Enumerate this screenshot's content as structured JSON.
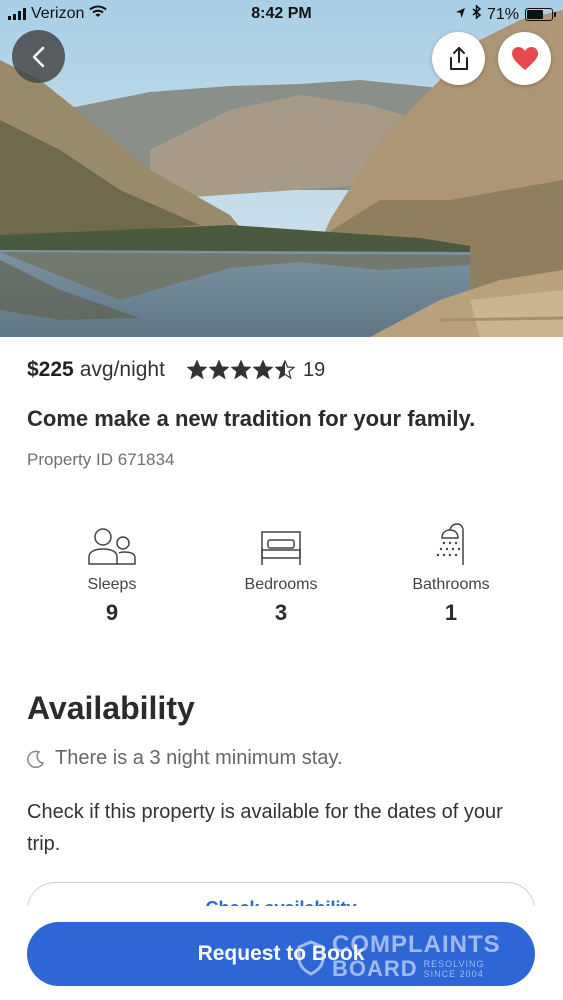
{
  "status_bar": {
    "carrier": "Verizon",
    "time": "8:42 PM",
    "battery_percent": "71%",
    "battery_level": 0.71,
    "icons": [
      "signal-icon",
      "wifi-icon",
      "location-arrow-icon",
      "bluetooth-icon",
      "battery-icon"
    ]
  },
  "header": {
    "back_icon": "chevron-left-icon",
    "share_icon": "share-icon",
    "favorite_icon": "heart-icon",
    "favorite_color": "#e5484d"
  },
  "listing": {
    "price": "$225",
    "price_unit": "avg/night",
    "rating": 4.5,
    "review_count": "19",
    "headline": "Come make a new tradition for your family.",
    "property_id": "Property ID 671834"
  },
  "facts": [
    {
      "icon": "people-icon",
      "label": "Sleeps",
      "value": "9"
    },
    {
      "icon": "bed-icon",
      "label": "Bedrooms",
      "value": "3"
    },
    {
      "icon": "shower-icon",
      "label": "Bathrooms",
      "value": "1"
    }
  ],
  "availability": {
    "title": "Availability",
    "minimum_stay_icon": "moon-icon",
    "minimum_stay": "There is a 3 night minimum stay.",
    "description": "Check if this property is available for the dates of your trip.",
    "check_button": "Check availability"
  },
  "footer": {
    "book_button": "Request to Book",
    "accent_color": "#2e66d6"
  },
  "watermark": {
    "line1": "COMPLAINTS",
    "line2": "BOARD",
    "tag1": "RESOLVING",
    "tag2": "SINCE 2004"
  }
}
